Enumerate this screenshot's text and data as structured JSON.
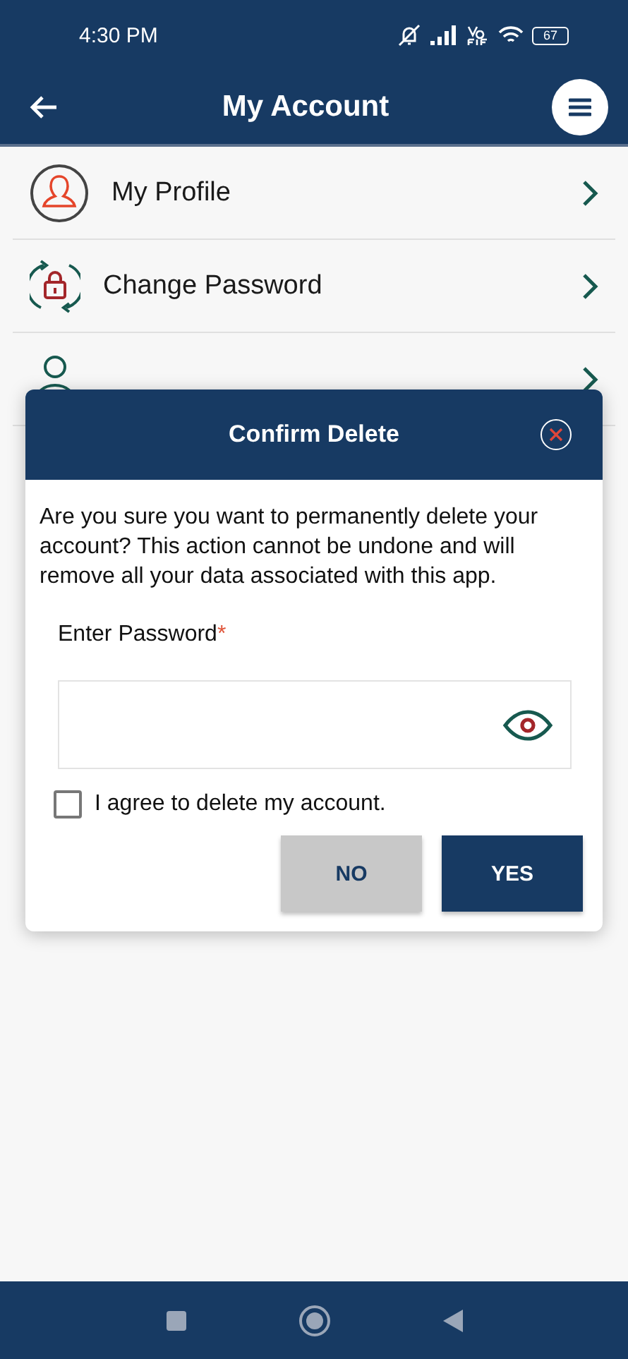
{
  "status_bar": {
    "time": "4:30 PM",
    "battery": "67"
  },
  "header": {
    "title": "My Account"
  },
  "menu": {
    "items": [
      {
        "kind": "profile",
        "label": "My Profile"
      },
      {
        "kind": "password",
        "label": "Change Password"
      },
      {
        "kind": "delete"
      }
    ]
  },
  "dialog": {
    "title": "Confirm Delete",
    "message": "Are you sure you want to permanently delete your account? This action cannot be undone and will remove all your data associated with this app.",
    "password_label": "Enter Password",
    "required_mark": "*",
    "agree": {
      "label": "I agree to delete my account.",
      "checked": false
    },
    "buttons": [
      {
        "kind": "secondary",
        "label": "NO"
      },
      {
        "kind": "primary",
        "label": "YES"
      }
    ]
  }
}
